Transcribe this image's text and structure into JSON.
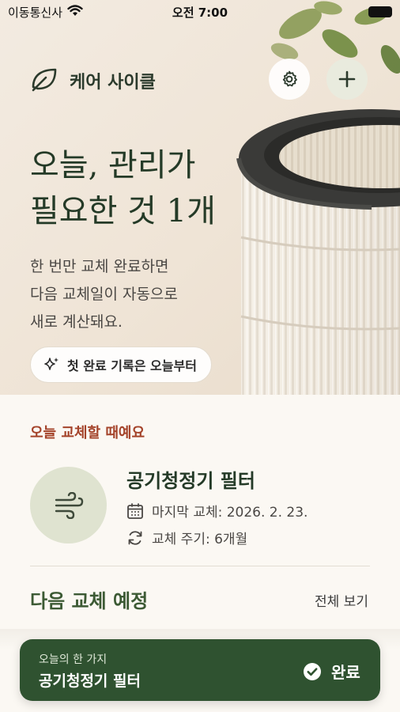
{
  "status_bar": {
    "carrier": "이동통신사",
    "time": "오전 7:00"
  },
  "header": {
    "app_title": "케어 사이클",
    "logo_icon": "leaf-icon",
    "settings_icon": "gear-icon",
    "add_icon": "plus-icon"
  },
  "hero": {
    "heading_line1": "오늘, 관리가",
    "heading_line2": "필요한 것 1개",
    "desc_line1": "한 번만 교체 완료하면",
    "desc_line2": "다음 교체일이 자동으로",
    "desc_line3": "새로 계산돼요.",
    "chip_label": "첫 완료 기록은 오늘부터",
    "chip_icon": "sparkle-icon"
  },
  "today": {
    "section_label": "오늘 교체할 때예요",
    "item_name": "공기청정기 필터",
    "item_icon": "wind-icon",
    "last_replaced": "마지막 교체: 2026. 2. 23.",
    "cycle": "교체 주기: 6개월"
  },
  "upcoming": {
    "title": "다음 교체 예정",
    "see_all": "전체 보기"
  },
  "bottom_bar": {
    "caption": "오늘의 한 가지",
    "item": "공기청정기 필터",
    "done_label": "완료",
    "done_icon": "check-circle-icon"
  },
  "colors": {
    "primary_green": "#2f5230",
    "heading_green": "#243a27",
    "accent_rust": "#a4432a",
    "avatar_sage": "#dfe3d0",
    "background": "#fbf8f3"
  }
}
